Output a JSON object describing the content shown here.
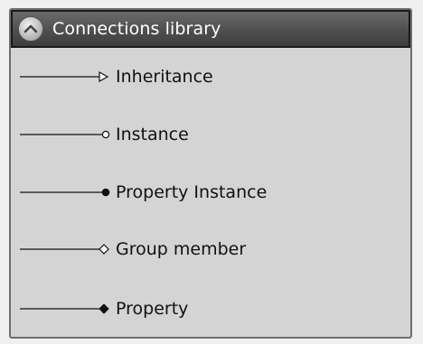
{
  "panel": {
    "title": "Connections library",
    "collapse_icon": "chevron-up-icon"
  },
  "connections": [
    {
      "label": "Inheritance",
      "marker": "open-triangle-arrow"
    },
    {
      "label": "Instance",
      "marker": "open-circle"
    },
    {
      "label": "Property Instance",
      "marker": "filled-circle"
    },
    {
      "label": "Group member",
      "marker": "open-diamond"
    },
    {
      "label": "Property",
      "marker": "filled-diamond"
    }
  ]
}
